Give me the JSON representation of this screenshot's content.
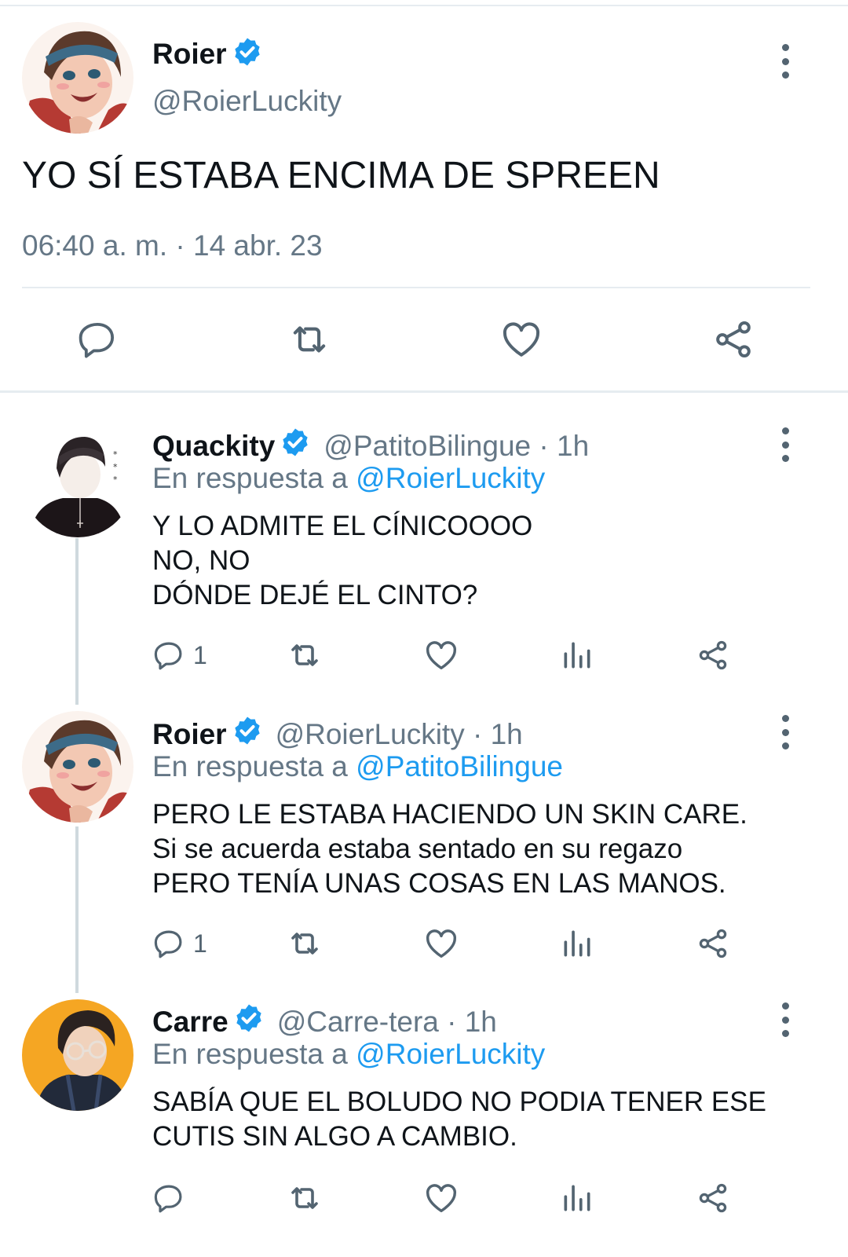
{
  "main_tweet": {
    "author_name": "Roier",
    "author_handle": "@RoierLuckity",
    "text": "YO SÍ ESTABA ENCIMA DE SPREEN",
    "timestamp": "06:40 a. m. · 14 abr. 23"
  },
  "replies": [
    {
      "author_name": "Quackity",
      "author_handle": "@PatitoBilingue · 1h",
      "reply_prefix": "En respuesta a ",
      "reply_to": "@RoierLuckity",
      "text": "Y LO ADMITE EL CÍNICOOOO\nNO, NO\nDÓNDE DEJÉ EL CINTO?",
      "reply_count": "1"
    },
    {
      "author_name": "Roier",
      "author_handle": "@RoierLuckity · 1h",
      "reply_prefix": "En respuesta a ",
      "reply_to": "@PatitoBilingue",
      "text": "PERO LE ESTABA HACIENDO UN SKIN CARE.\nSi se acuerda estaba sentado en su regazo\nPERO TENÍA UNAS COSAS EN LAS MANOS.",
      "reply_count": "1"
    },
    {
      "author_name": "Carre",
      "author_handle": "@Carre-tera · 1h",
      "reply_prefix": "En respuesta a ",
      "reply_to": "@RoierLuckity",
      "text": "SABÍA QUE EL BOLUDO NO PODIA TENER ESE\nCUTIS SIN ALGO A CAMBIO.",
      "reply_count": ""
    }
  ],
  "icons": [
    "reply-icon",
    "retweet-icon",
    "like-icon",
    "share-icon",
    "analytics-icon",
    "verified-badge-icon",
    "more-icon"
  ],
  "colors": {
    "accent": "#1d9bf0",
    "muted_text": "#657786",
    "icon_gray": "#536471",
    "divider": "#e6ecf0"
  }
}
